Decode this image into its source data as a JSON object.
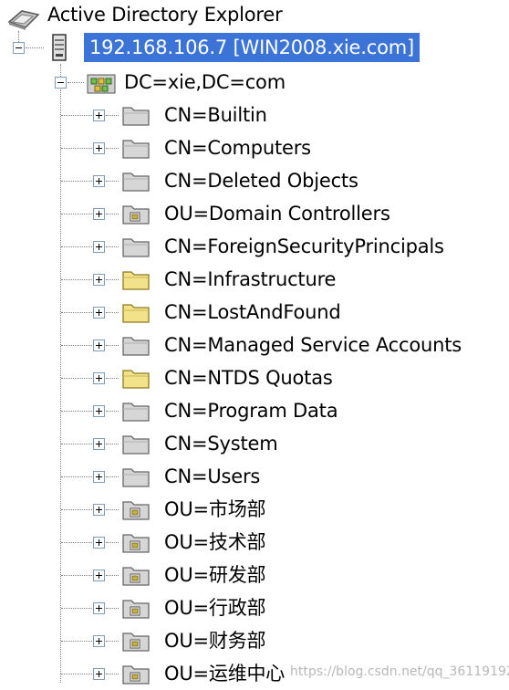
{
  "window": {
    "title": "Active Directory Explorer"
  },
  "server": {
    "label": "192.168.106.7 [WIN2008.xie.com]"
  },
  "domain": {
    "label": "DC=xie,DC=com"
  },
  "children": [
    {
      "label": "CN=Builtin",
      "icon": "container-icon"
    },
    {
      "label": "CN=Computers",
      "icon": "container-icon"
    },
    {
      "label": "CN=Deleted Objects",
      "icon": "container-icon"
    },
    {
      "label": "OU=Domain Controllers",
      "icon": "ou-icon"
    },
    {
      "label": "CN=ForeignSecurityPrincipals",
      "icon": "container-icon"
    },
    {
      "label": "CN=Infrastructure",
      "icon": "folder-icon"
    },
    {
      "label": "CN=LostAndFound",
      "icon": "folder-icon"
    },
    {
      "label": "CN=Managed Service Accounts",
      "icon": "container-icon"
    },
    {
      "label": "CN=NTDS Quotas",
      "icon": "folder-icon"
    },
    {
      "label": "CN=Program Data",
      "icon": "container-icon"
    },
    {
      "label": "CN=System",
      "icon": "container-icon"
    },
    {
      "label": "CN=Users",
      "icon": "container-icon"
    },
    {
      "label": "OU=市场部",
      "icon": "ou-icon"
    },
    {
      "label": "OU=技术部",
      "icon": "ou-icon"
    },
    {
      "label": "OU=研发部",
      "icon": "ou-icon"
    },
    {
      "label": "OU=行政部",
      "icon": "ou-icon"
    },
    {
      "label": "OU=财务部",
      "icon": "ou-icon"
    },
    {
      "label": "OU=运维中心",
      "icon": "ou-icon"
    }
  ],
  "watermark": "https://blog.csdn.net/qq_36119192",
  "colors": {
    "selection": "#3b73d6",
    "folder_yellow": "#f2e28a",
    "container_gray": "#d6d6d6",
    "ou_mark": "#c8b040"
  }
}
